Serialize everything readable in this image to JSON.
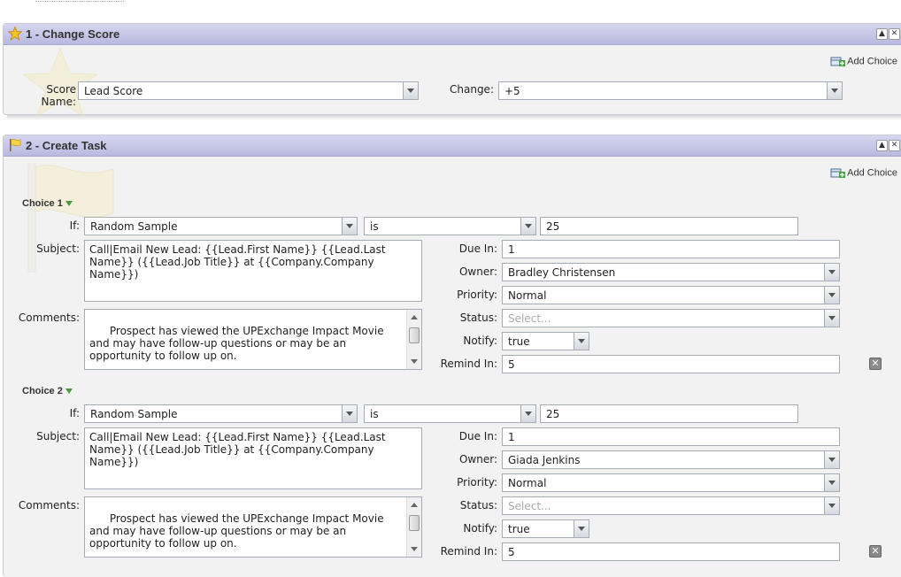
{
  "panel1": {
    "title": "1 - Change Score",
    "add_choice": "Add Choice",
    "score_name_label": "Score Name:",
    "score_name_value": "Lead Score",
    "change_label": "Change:",
    "change_value": "+5",
    "header_icon": "star-icon"
  },
  "panel2": {
    "title": "2 - Create Task",
    "add_choice": "Add Choice",
    "header_icon": "flag-icon",
    "choices": [
      {
        "label": "Choice 1",
        "if_label": "If:",
        "if_field": "Random Sample",
        "if_operator": "is",
        "if_value": "25",
        "subject_label": "Subject:",
        "subject": "Call|Email New Lead: {{Lead.First Name}} {{Lead.Last Name}} ({{Lead.Job Title}} at {{Company.Company Name}})",
        "comments_label": "Comments:",
        "comments": "Prospect has viewed the UPExchange Impact Movie and may have follow-up questions or may be an opportunity to follow up on.\n\nEmail Address: {{Lead.Email Address}}  Phone Number:",
        "due_in_label": "Due In:",
        "due_in": "1",
        "owner_label": "Owner:",
        "owner": "Bradley Christensen",
        "priority_label": "Priority:",
        "priority": "Normal",
        "status_label": "Status:",
        "status_placeholder": "Select...",
        "notify_label": "Notify:",
        "notify": "true",
        "remind_in_label": "Remind In:",
        "remind_in": "5"
      },
      {
        "label": "Choice 2",
        "if_label": "If:",
        "if_field": "Random Sample",
        "if_operator": "is",
        "if_value": "25",
        "subject_label": "Subject:",
        "subject": "Call|Email New Lead: {{Lead.First Name}} {{Lead.Last Name}} ({{Lead.Job Title}} at {{Company.Company Name}})",
        "comments_label": "Comments:",
        "comments": "Prospect has viewed the UPExchange Impact Movie and may have follow-up questions or may be an opportunity to follow up on.\n\nEmail Address: {{Lead.Email Address}}  Phone Number:",
        "due_in_label": "Due In:",
        "due_in": "1",
        "owner_label": "Owner:",
        "owner": "Giada Jenkins",
        "priority_label": "Priority:",
        "priority": "Normal",
        "status_label": "Status:",
        "status_placeholder": "Select...",
        "notify_label": "Notify:",
        "notify": "true",
        "remind_in_label": "Remind In:",
        "remind_in": "5"
      }
    ]
  },
  "colors": {
    "header_gradient_top": "#d6d6ef",
    "header_gradient_bottom": "#b9b9e0",
    "panel_bg": "#f2f2f2",
    "choice_arrow": "#4a9a3a"
  }
}
